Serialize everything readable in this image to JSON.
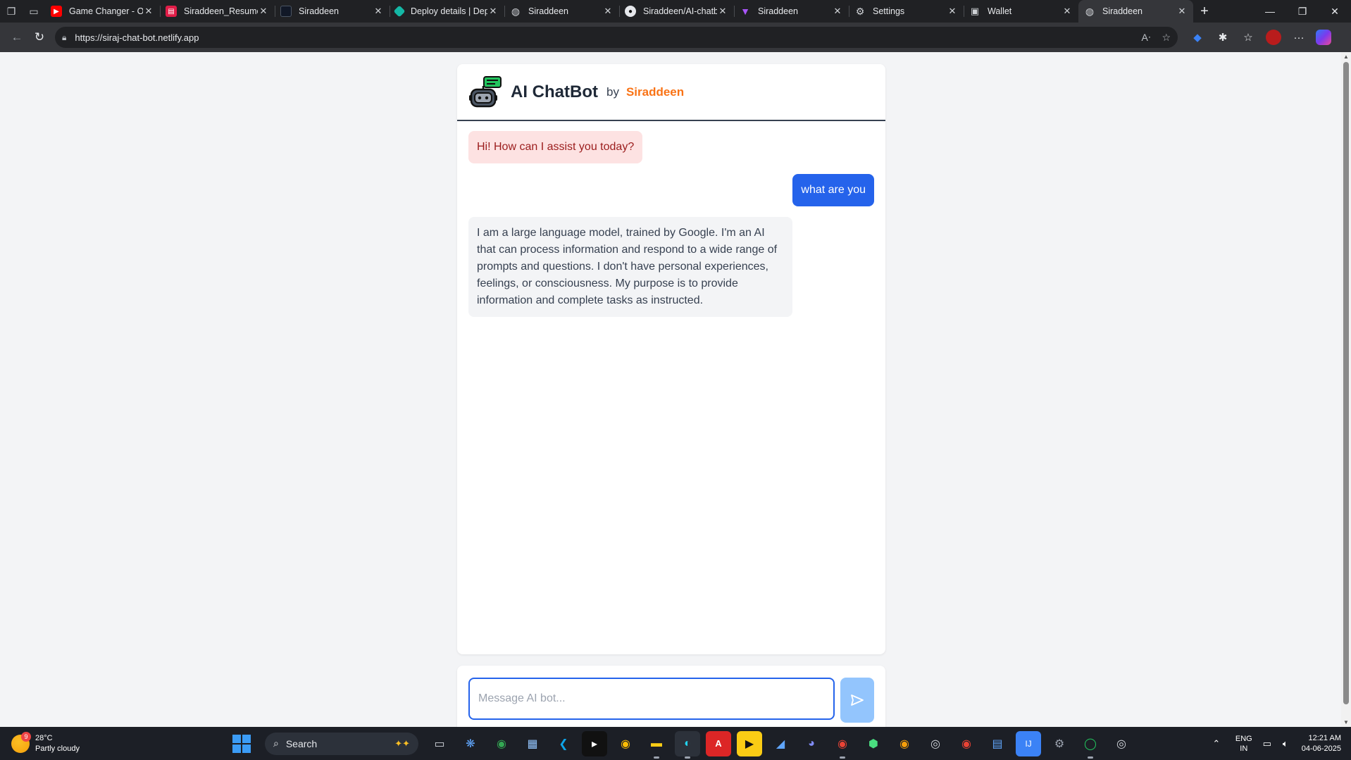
{
  "browser": {
    "tabs": [
      {
        "title": "Game Changer - Official",
        "favicon": "youtube-icon",
        "color": "#ff0000",
        "active": false
      },
      {
        "title": "Siraddeen_Resume",
        "favicon": "pdf-icon",
        "color": "#e11d48",
        "active": false
      },
      {
        "title": "Siraddeen",
        "favicon": "page-icon",
        "color": "#111827",
        "active": false
      },
      {
        "title": "Deploy details | Deploys",
        "favicon": "netlify-icon",
        "color": "#14b8a6",
        "active": false
      },
      {
        "title": "Siraddeen",
        "favicon": "globe-icon",
        "color": "#9ca3af",
        "active": false
      },
      {
        "title": "Siraddeen/AI-chatbot",
        "favicon": "github-icon",
        "color": "#e5e7eb",
        "active": false
      },
      {
        "title": "Siraddeen",
        "favicon": "vite-icon",
        "color": "#a855f7",
        "active": false
      },
      {
        "title": "Settings",
        "favicon": "gear-icon",
        "color": "#9ca3af",
        "active": false
      },
      {
        "title": "Wallet",
        "favicon": "wallet-icon",
        "color": "#9ca3af",
        "active": false
      },
      {
        "title": "Siraddeen",
        "favicon": "globe-icon",
        "color": "#9ca3af",
        "active": true
      }
    ],
    "url": "https://siraj-chat-bot.netlify.app"
  },
  "chat": {
    "title": "AI ChatBot",
    "by": "by",
    "author": "Siraddeen",
    "messages": [
      {
        "role": "bot",
        "text": "Hi! How can I assist you today?"
      },
      {
        "role": "user",
        "text": "what are you"
      },
      {
        "role": "bot",
        "text": "I am a large language model, trained by Google. I'm an AI that can process information and respond to a wide range of prompts and questions. I don't have personal experiences, feelings, or consciousness. My purpose is to provide information and complete tasks as instructed."
      }
    ],
    "input_placeholder": "Message AI bot...",
    "colors": {
      "accent": "#2563eb",
      "author": "#f97316",
      "greeting_bg": "#fde2e2"
    }
  },
  "taskbar": {
    "weather_temp": "28°C",
    "weather_desc": "Partly cloudy",
    "weather_badge": "9",
    "search_label": "Search",
    "lang_line1": "ENG",
    "lang_line2": "IN",
    "time": "12:21 AM",
    "date": "04-06-2025",
    "apps": [
      "task-view-icon",
      "copilot-icon",
      "chrome-icon",
      "photos-icon",
      "vscode-icon",
      "terminal-icon",
      "chrome-icon",
      "file-explorer-icon",
      "edge-icon",
      "acrobat-icon",
      "player-icon",
      "sql-icon",
      "discord-icon",
      "chrome-icon",
      "node-icon",
      "chrome-icon",
      "obs-icon",
      "chrome-icon",
      "notepad-icon",
      "intellij-icon",
      "settings-icon",
      "whatsapp-icon",
      "app-icon"
    ]
  }
}
